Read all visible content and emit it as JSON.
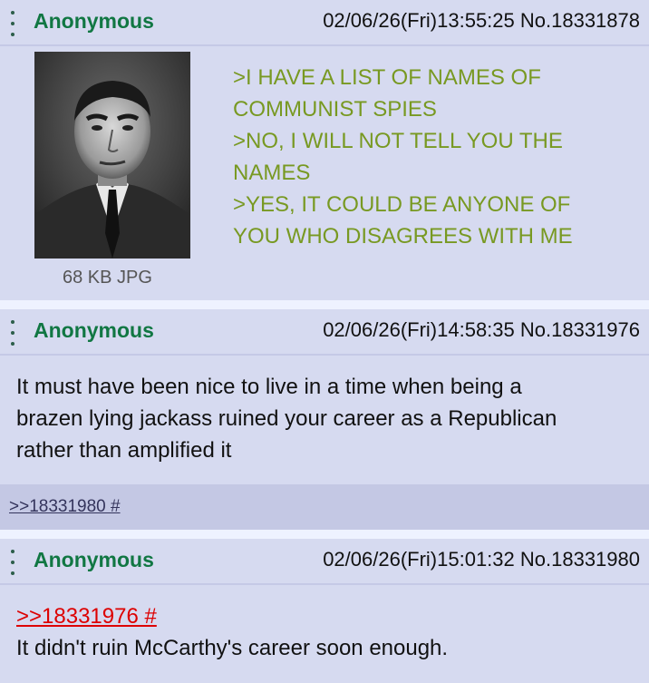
{
  "posts": [
    {
      "name": "Anonymous",
      "meta": "02/06/26(Fri)13:55:25 No.18331878",
      "file_info": "68 KB JPG",
      "lines": [
        ">I HAVE A LIST OF NAMES OF",
        "COMMUNIST SPIES",
        ">NO, I WILL NOT TELL YOU THE",
        "NAMES",
        ">YES, IT COULD BE ANYONE OF",
        "YOU WHO DISAGREES WITH ME"
      ]
    },
    {
      "name": "Anonymous",
      "meta": "02/06/26(Fri)14:58:35 No.18331976",
      "lines": [
        "It must have been nice to live in a time when being a",
        "brazen lying jackass ruined your career as a Republican",
        "rather than amplified it"
      ],
      "backlink": ">>18331980 #"
    },
    {
      "name": "Anonymous",
      "meta": "02/06/26(Fri)15:01:32 No.18331980",
      "quote": ">>18331976 #",
      "lines": [
        "It didn't ruin McCarthy's career soon enough."
      ]
    }
  ],
  "colors": {
    "name": "#117743",
    "greentext": "#789922",
    "reply_quote": "#dd0000",
    "post_bg": "#d6daf0",
    "page_bg": "#eef2ff"
  },
  "icons": [
    "more-vertical-icon"
  ]
}
